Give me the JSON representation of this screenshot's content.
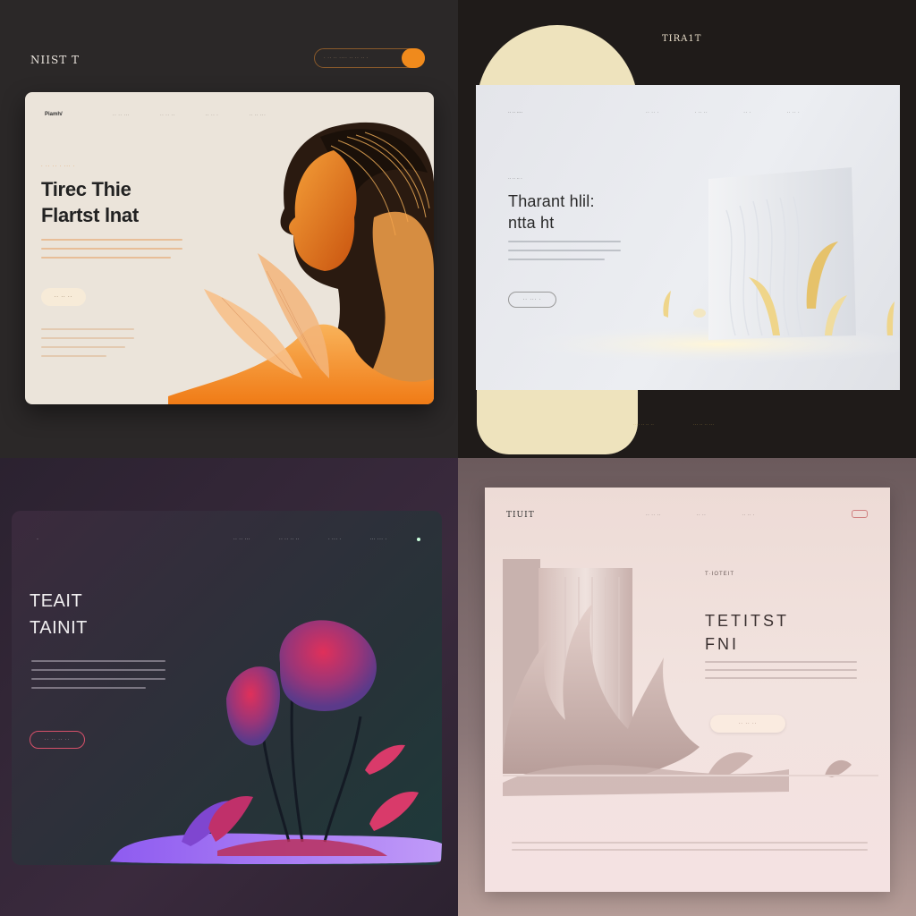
{
  "q1": {
    "brand": "NIIST T",
    "search_placeholder": "·  ·· ·· ···· ·· ·· ·· ·",
    "logo": "Piamh/",
    "nav": [
      "·· ·· ···",
      "·· ·· ··",
      "·· ·· ·",
      "·· ·· ···"
    ],
    "eyebrow": "· ·· ·· · ··· ·",
    "title_line1": "Tirec Thie",
    "title_line2": "Flartst lnat",
    "cta": "·· ·· ··",
    "colors": {
      "accent": "#f08a1c",
      "bg": "#2b2828",
      "card": "#ebe4da"
    }
  },
  "q2": {
    "brand": "TIRA1T",
    "logo": "·· ·· ····",
    "nav": [
      "·· ·· ·",
      "· ·· ··",
      "·· ·",
      "·· ·· ·"
    ],
    "eyebrow": "·· ·· ·· ·",
    "title_line1": "Tharant hlil:",
    "title_line2": "ntta ht",
    "cta": "·· ··· ·",
    "footer": [
      "···· ·· ·· ··",
      "··· ·· ·· ···"
    ],
    "colors": {
      "accent": "#eee3bd",
      "bg": "#1f1b19"
    }
  },
  "q3": {
    "logo": "·",
    "nav": [
      "·· ·· ···",
      "·· ·· ·· ··",
      "· ··· ·",
      "··· ··· ·"
    ],
    "title_line1": "TEAIT",
    "title_line2": "TAINIT",
    "cta": "·· ·· ·· ··",
    "colors": {
      "accent": "#d6506a",
      "bloom": "#a8356e"
    }
  },
  "q4": {
    "logo": "TIUIT",
    "nav": [
      "·· ·· ··",
      "·· ··",
      "·· ·· ·"
    ],
    "eyebrow": "T·IOTEIT",
    "title_line1": "TETITST",
    "title_line2": "FNI",
    "cta": "·· ·· ··",
    "colors": {
      "accent": "#d08080",
      "card": "#f2e3df"
    }
  }
}
